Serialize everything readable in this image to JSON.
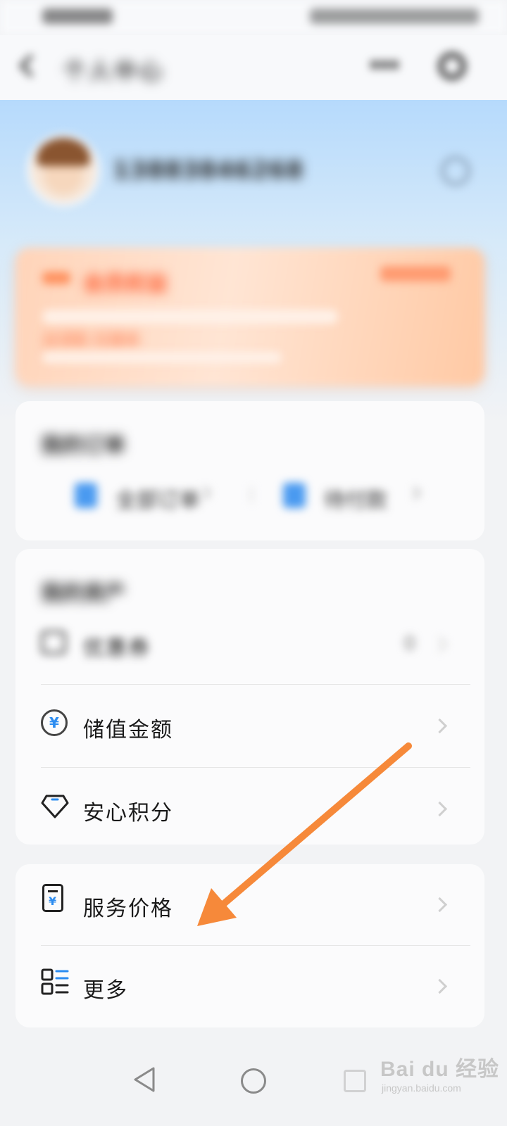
{
  "status_bar": {},
  "app_bar": {
    "title": "个人中心"
  },
  "profile": {
    "phone": "13883846268"
  },
  "promo": {
    "title": "会员权益",
    "subtitle": "去领取 优惠券"
  },
  "orders": {
    "title": "我的订单",
    "items": [
      {
        "label": "全部订单"
      },
      {
        "label": "待付款"
      }
    ]
  },
  "assets": {
    "title": "我的资产",
    "rows": [
      {
        "label": "优惠券",
        "count": "0",
        "icon": "coupon-icon"
      },
      {
        "label": "储值金额",
        "icon": "yen-circle-icon"
      },
      {
        "label": "安心积分",
        "icon": "diamond-icon"
      }
    ]
  },
  "more_menu": {
    "rows": [
      {
        "label": "服务价格",
        "icon": "price-list-icon"
      },
      {
        "label": "更多",
        "icon": "grid-list-icon"
      }
    ]
  },
  "colors": {
    "accent_blue": "#2c8cf0",
    "annotation_arrow": "#f6893a",
    "promo_orange": "#ff5a2c"
  },
  "watermark": {
    "brand": "Bai du 经验",
    "sub": "jingyan.baidu.com"
  }
}
